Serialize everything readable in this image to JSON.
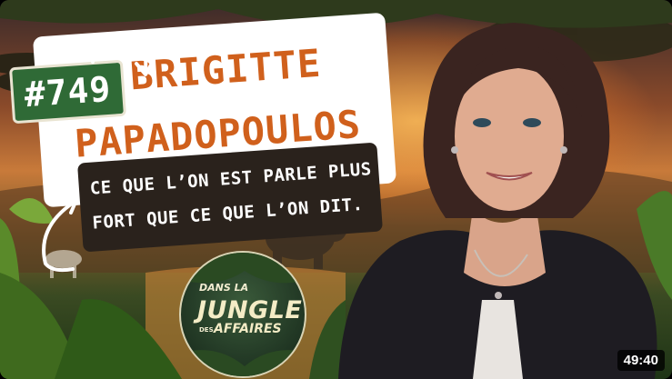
{
  "thumbnail": {
    "episode_number": "#749",
    "guest_name_line1": "BRIGITTE",
    "guest_name_line2": "PAPADOPOULOS",
    "quote_line1": "CE QUE L’ON EST PARLE PLUS",
    "quote_line2": "FORT QUE CE QUE L’ON DIT.",
    "logo": {
      "dans": "DANS LA",
      "jungle": "JUNGLE",
      "des": "DES",
      "affaires": "AFFAIRES"
    },
    "duration": "49:40"
  },
  "colors": {
    "badge_green": "#2f6a36",
    "name_orange": "#d0601c",
    "quote_bg": "#2a221c",
    "card_white": "#ffffff"
  },
  "icons": [
    "curved-arrow-icon",
    "curved-arrow-icon"
  ]
}
